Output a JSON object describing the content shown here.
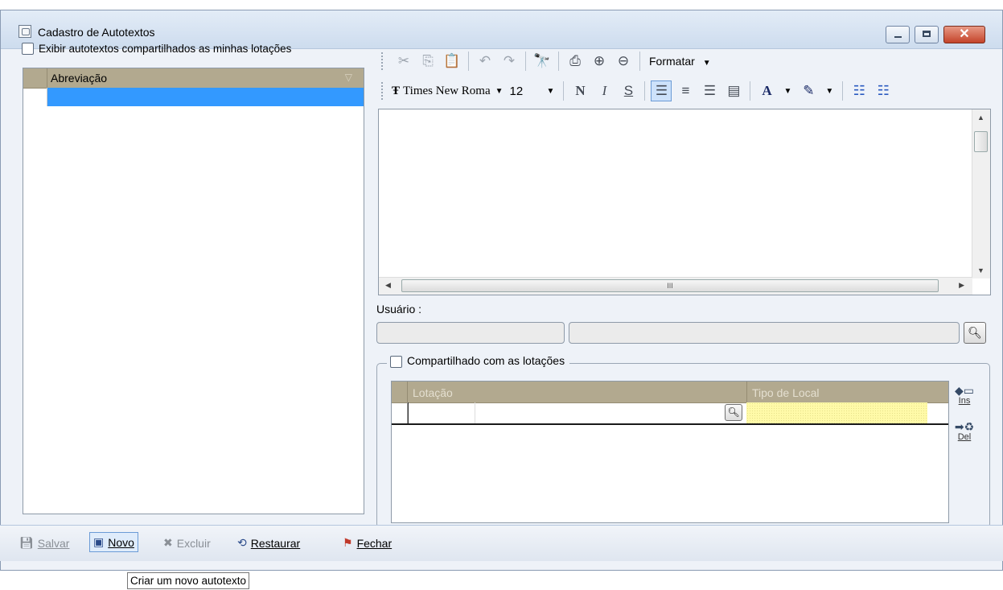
{
  "window": {
    "title": "Cadastro de Autotextos"
  },
  "left_panel": {
    "show_shared_label": "Exibir autotextos compartilhados as minhas lotações",
    "list_header": "Abreviação"
  },
  "toolbar": {
    "format_menu": "Formatar",
    "font_name": "Times New Roma",
    "font_size": "12",
    "bold_glyph": "N",
    "italic_glyph": "I",
    "underline_glyph": "S",
    "font_color_glyph": "A"
  },
  "editor": {
    "hscroll_grip": "III"
  },
  "user": {
    "label": "Usuário :"
  },
  "shared": {
    "label": "Compartilhado com as lotações",
    "columns": [
      "Lotação",
      "Tipo de Local"
    ],
    "ins_label": "Ins",
    "del_label": "Del"
  },
  "bottom_bar": {
    "salvar": "Salvar",
    "novo": "Novo",
    "excluir": "Excluir",
    "restaurar": "Restaurar",
    "fechar": "Fechar"
  },
  "tooltip": "Criar um novo autotexto",
  "colors": {
    "grid_header": "#b2a98f",
    "selection": "#3399ff",
    "required_field": "#fffaa8",
    "close_button": "#c4432a"
  }
}
